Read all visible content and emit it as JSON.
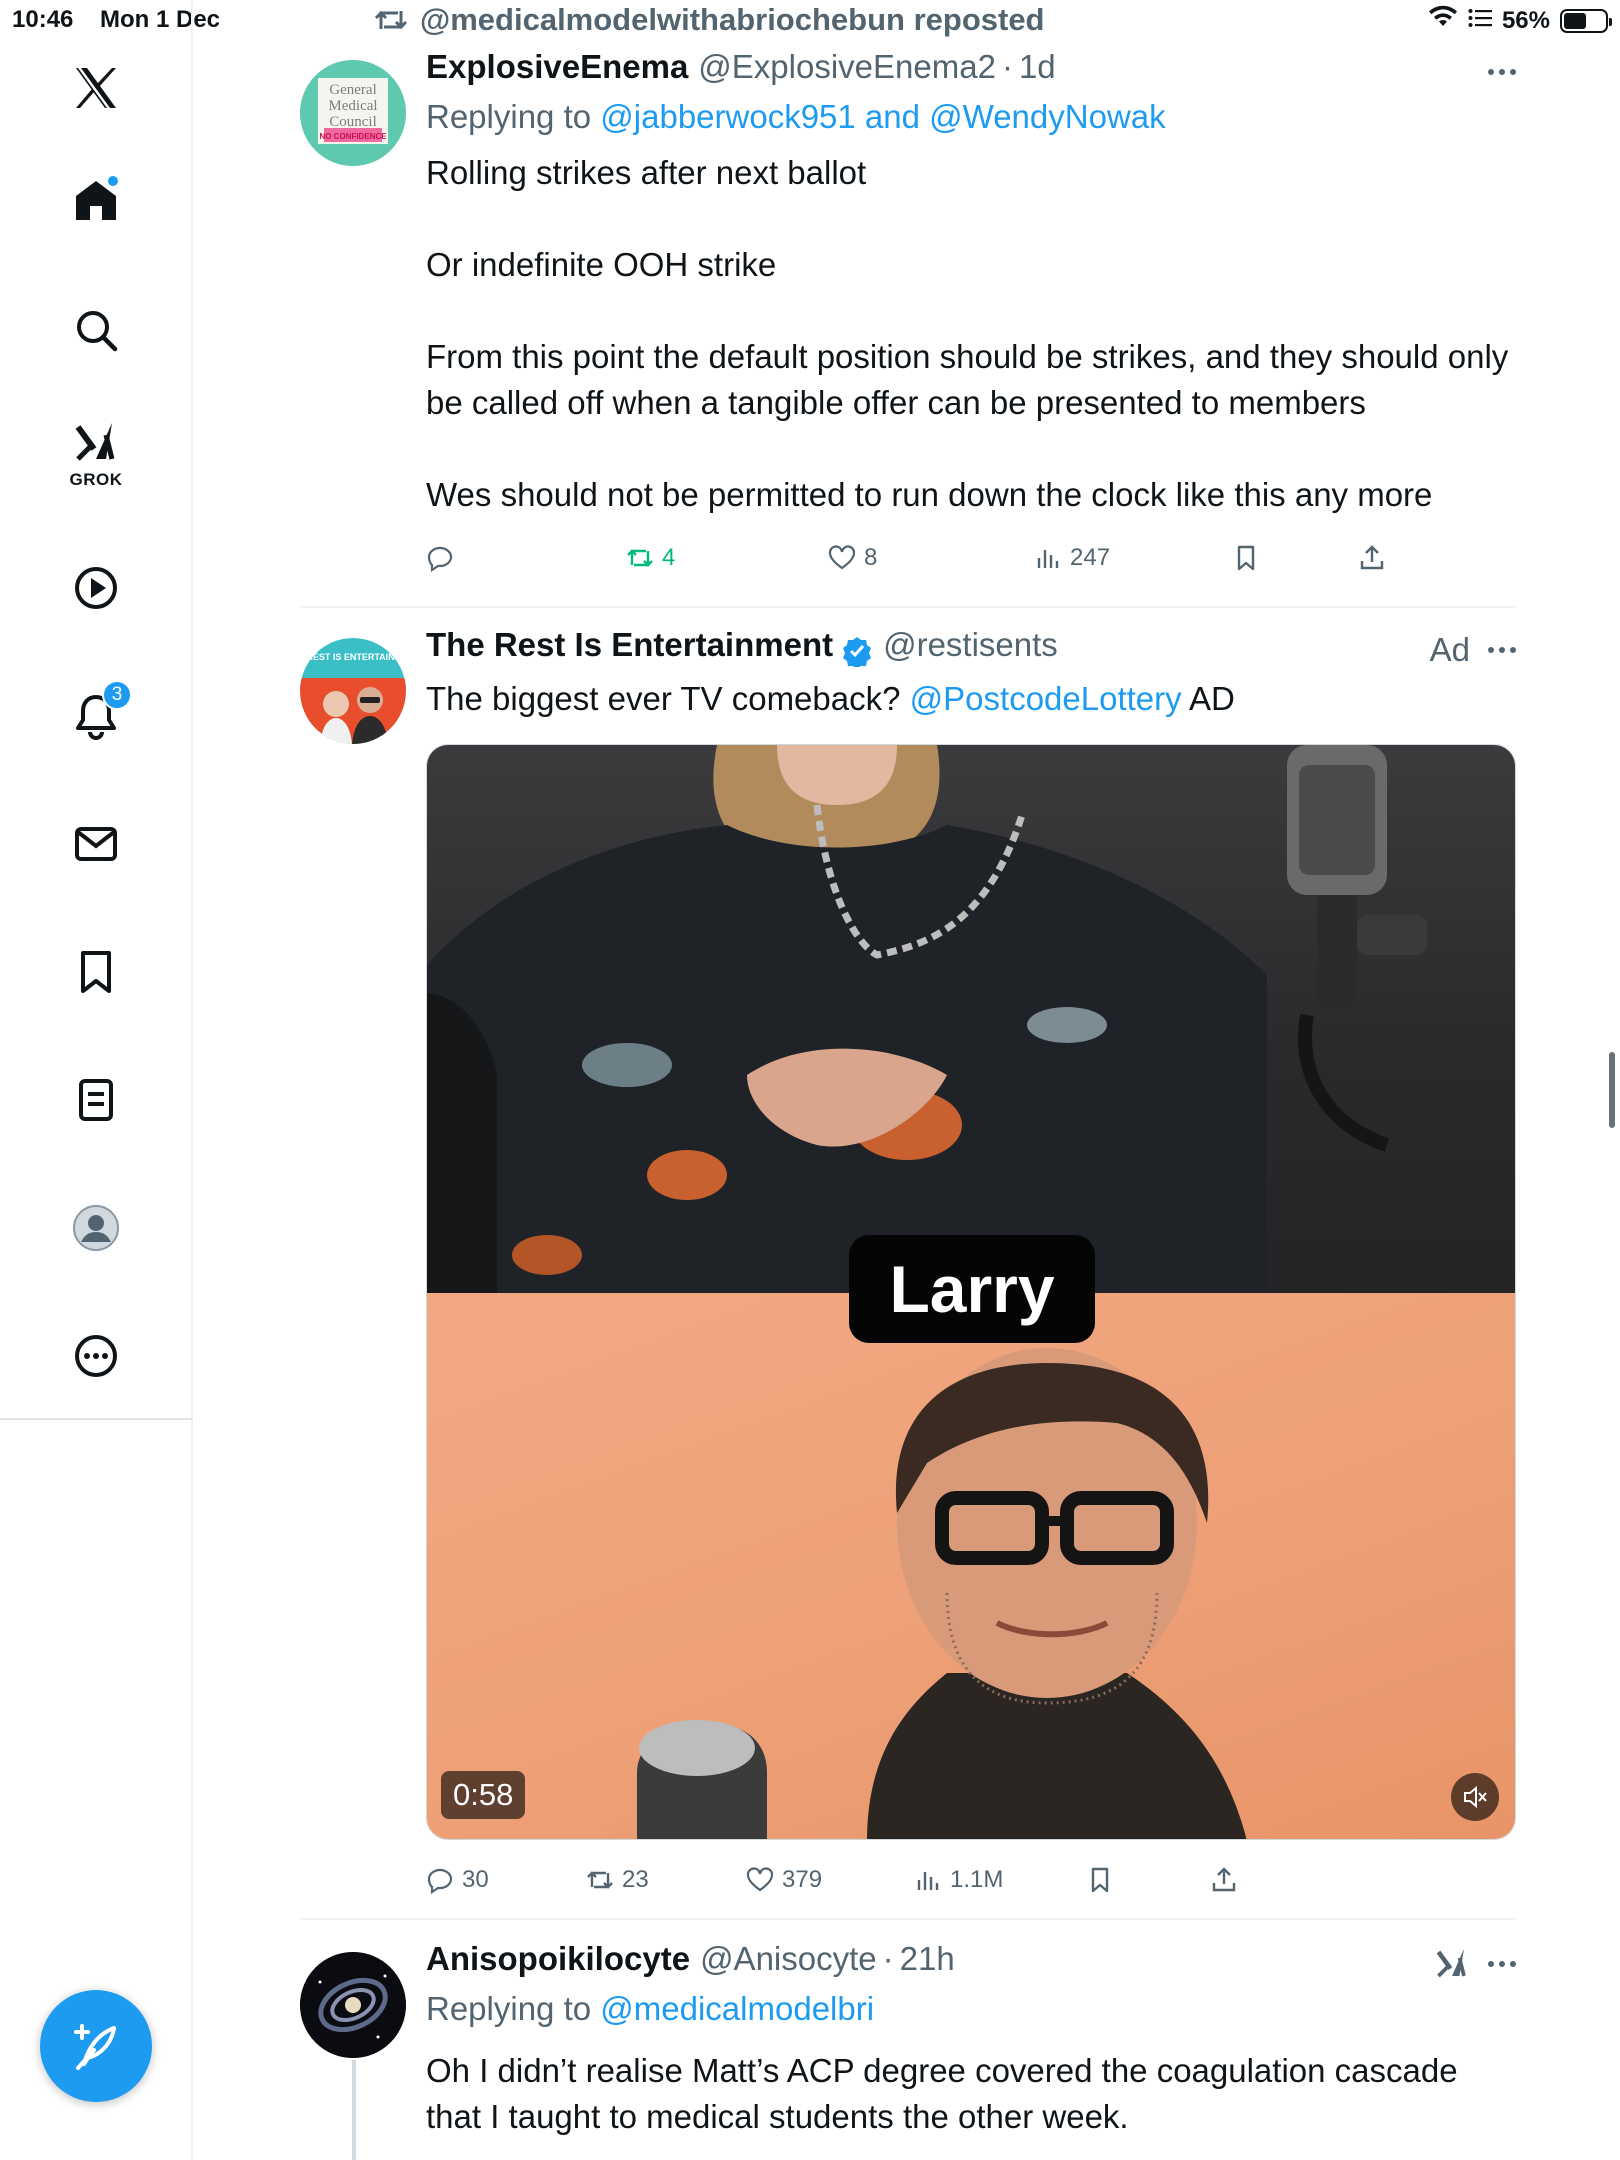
{
  "status_bar": {
    "time": "10:46",
    "date": "Mon 1 Dec",
    "battery": "56%",
    "battery_level": 0.56
  },
  "sidebar": {
    "items": [
      {
        "name": "X",
        "icon": "x-logo-icon"
      },
      {
        "name": "Home",
        "icon": "home-icon",
        "has_dot": true
      },
      {
        "name": "Search",
        "icon": "search-icon"
      },
      {
        "name": "Grok",
        "icon": "grok-icon",
        "label": "GROK"
      },
      {
        "name": "Video",
        "icon": "play-icon"
      },
      {
        "name": "Notifications",
        "icon": "bell-icon",
        "badge": "3"
      },
      {
        "name": "Messages",
        "icon": "mail-icon"
      },
      {
        "name": "Bookmarks",
        "icon": "bookmark-icon"
      },
      {
        "name": "Lists",
        "icon": "list-icon"
      },
      {
        "name": "Profile",
        "icon": "profile-avatar-icon"
      },
      {
        "name": "More",
        "icon": "more-circle-icon"
      }
    ],
    "compose_icon": "compose-feather-icon"
  },
  "feed": {
    "repost_line": "@medicalmodelwithabriochebun reposted",
    "tweets": [
      {
        "name": "ExplosiveEnema",
        "handle": "@ExplosiveEnema2",
        "time": "1d",
        "replying_prefix": "Replying to",
        "replying_to": "@jabberwock951 and @WendyNowak",
        "paragraphs": [
          "Rolling strikes after next ballot",
          "Or indefinite OOH strike",
          "From this point the default position should be strikes, and they should only be called off when a tangible offer can be presented to members",
          "Wes should not be permitted to run down the clock like this any more"
        ],
        "avatar": {
          "lines": [
            "General",
            "Medical",
            "Council"
          ],
          "stamp": "NO CONFIDENCE",
          "background": "#5fc9b0"
        },
        "stats": {
          "replies": "",
          "reposts": "4",
          "likes": "8",
          "views": "247"
        }
      },
      {
        "name": "The Rest Is Entertainment",
        "handle": "@restisents",
        "verified": true,
        "ad_label": "Ad",
        "text_before": "The biggest ever TV comeback?",
        "text_mention": "@PostcodeLottery",
        "text_after": "AD",
        "avatar": {
          "banner": "THE REST IS ENTERTAINMENT"
        },
        "video": {
          "caption": "Larry",
          "duration": "0:58",
          "muted": true
        },
        "stats": {
          "replies": "30",
          "reposts": "23",
          "likes": "379",
          "views": "1.1M"
        }
      },
      {
        "name": "Anisopoikilocyte",
        "handle": "@Anisocyte",
        "time": "21h",
        "replying_prefix": "Replying to",
        "replying_to": "@medicalmodelbri",
        "text": "Oh I didn’t realise Matt’s ACP degree covered the coagulation cascade that I taught to medical students the other week.",
        "grok_icon": "grok-icon"
      }
    ]
  },
  "colors": {
    "accent": "#1d9bf0",
    "text": "#0f1419",
    "secondary": "#536471",
    "repost_green": "#00ba7c",
    "divider": "#eff3f4"
  }
}
